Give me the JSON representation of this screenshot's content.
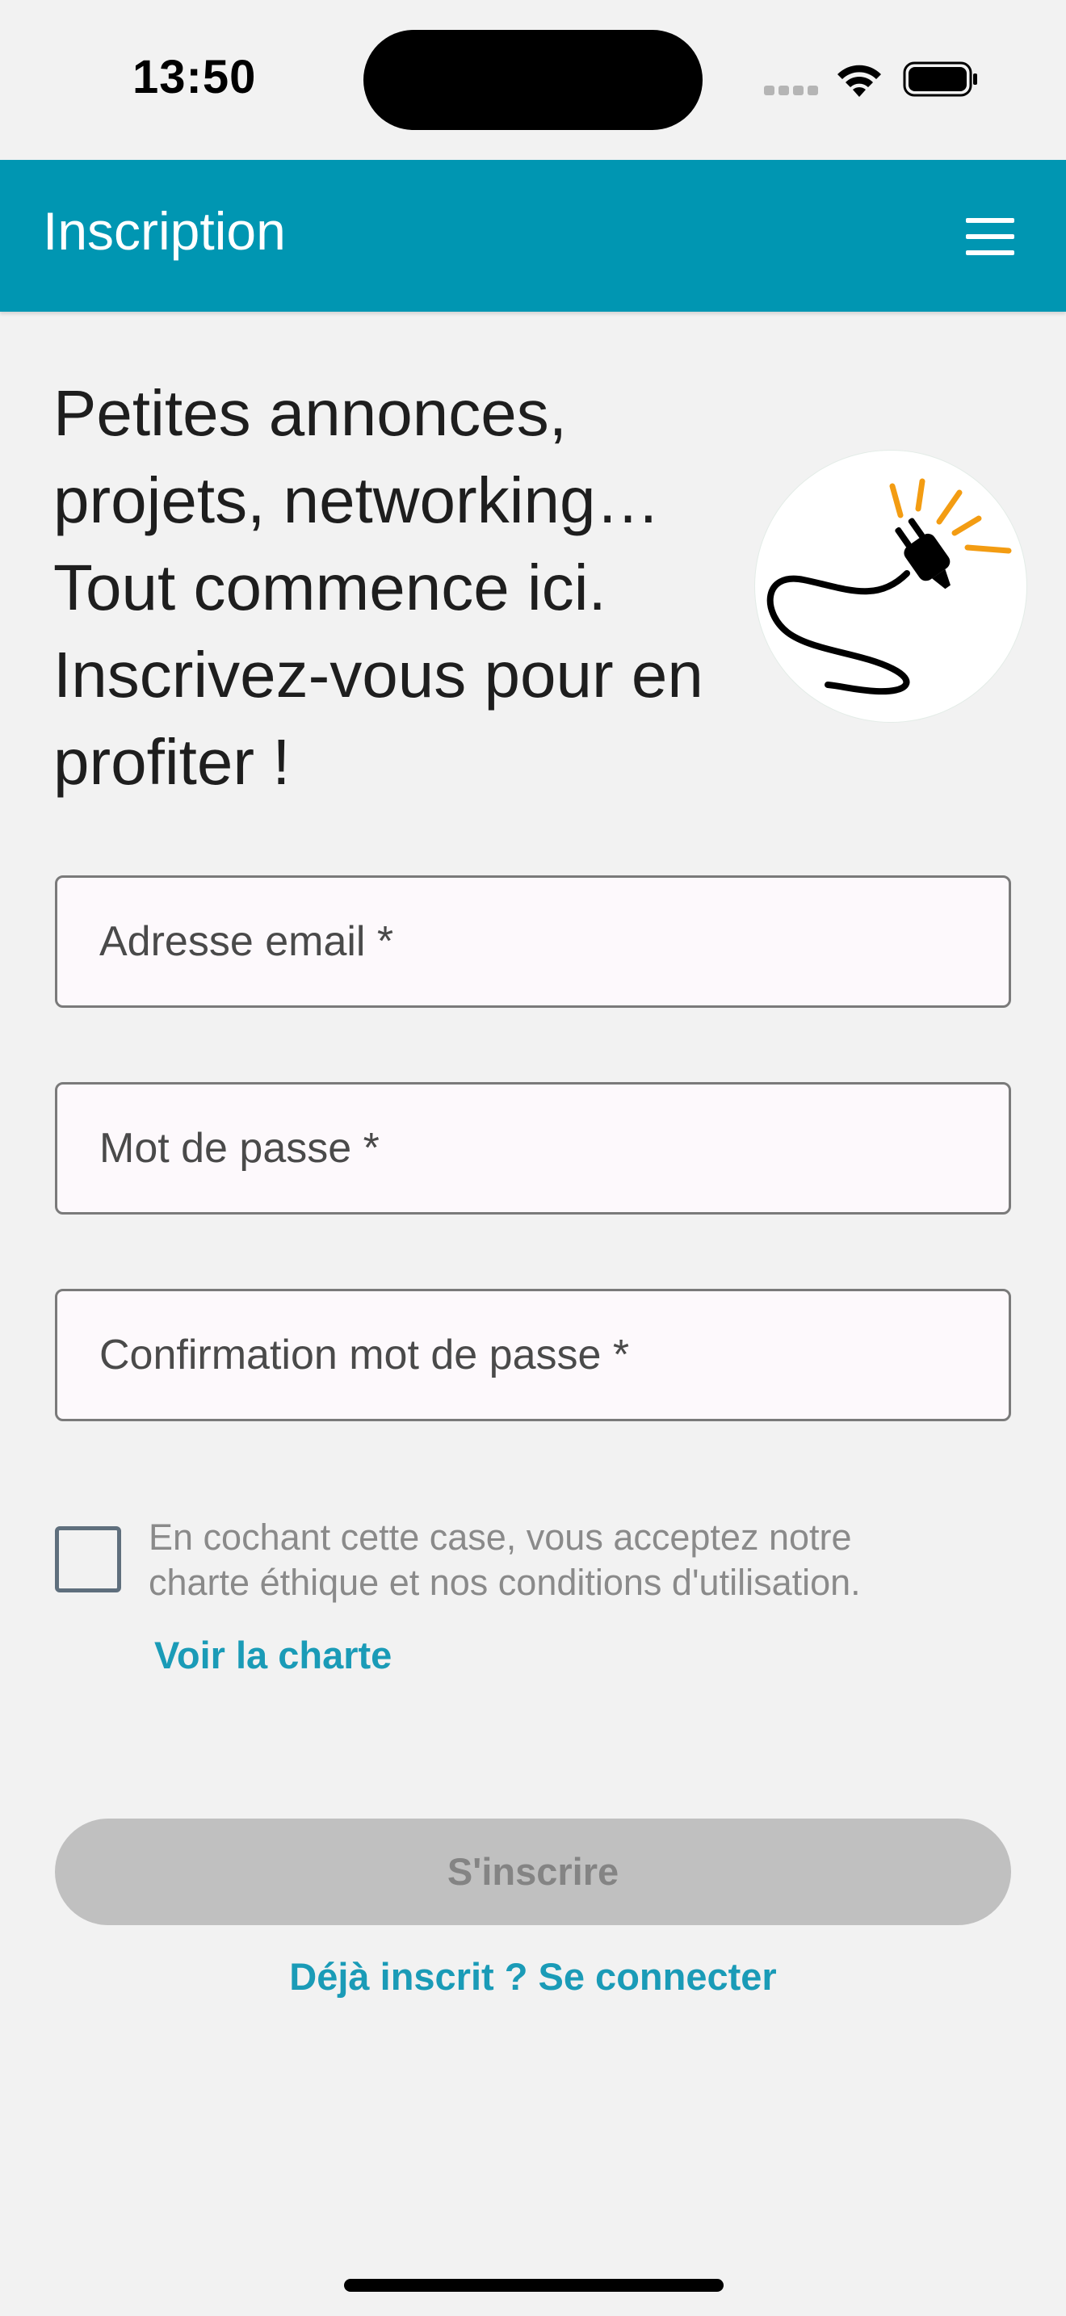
{
  "status_bar": {
    "time": "13:50"
  },
  "header": {
    "title": "Inscription",
    "menu_icon": "hamburger-menu-icon"
  },
  "intro": {
    "headline_lines": [
      "Petites annonces,",
      "projets, networking…",
      "Tout commence ici.",
      "Inscrivez-vous pour en",
      "profiter !"
    ],
    "logo_icon": "electric-plug-icon"
  },
  "form": {
    "email_placeholder": "Adresse email *",
    "email_value": "",
    "password_placeholder": "Mot de passe *",
    "password_value": "",
    "confirm_placeholder": "Confirmation mot de passe *",
    "confirm_value": "",
    "consent_checked": false,
    "consent_lines": [
      "En cochant cette case, vous acceptez notre",
      "charte éthique et nos conditions d'utilisation."
    ],
    "charter_link": "Voir la charte",
    "submit_label": "S'inscrire",
    "submit_enabled": false,
    "login_link": "Déjà inscrit ? Se connecter"
  },
  "colors": {
    "primary": "#0096b2",
    "link": "#1a9bb7",
    "background": "#f2f2f2",
    "disabled_button": "#c0c0c0",
    "plug_spark": "#f39c12"
  }
}
